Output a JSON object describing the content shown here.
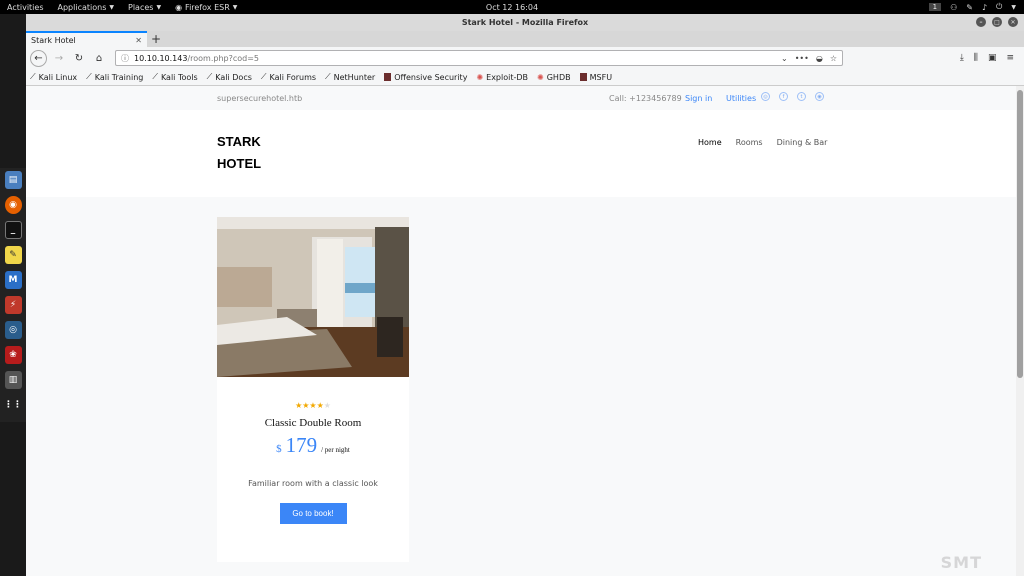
{
  "desktop": {
    "activities": "Activities",
    "applications": "Applications",
    "places": "Places",
    "app_menu": "Firefox ESR",
    "clock": "Oct 12  16:04",
    "workspace": "1"
  },
  "window": {
    "title": "Stark Hotel - Mozilla Firefox"
  },
  "tab": {
    "label": "Stark Hotel"
  },
  "urlbar": {
    "host": "10.10.10.143",
    "path": "/room.php?cod=5"
  },
  "bookmarks": [
    {
      "label": "Kali Linux"
    },
    {
      "label": "Kali Training"
    },
    {
      "label": "Kali Tools"
    },
    {
      "label": "Kali Docs"
    },
    {
      "label": "Kali Forums"
    },
    {
      "label": "NetHunter"
    },
    {
      "label": "Offensive Security"
    },
    {
      "label": "Exploit-DB"
    },
    {
      "label": "GHDB"
    },
    {
      "label": "MSFU"
    }
  ],
  "site": {
    "domain": "supersecurehotel.htb",
    "call": "Call: +123456789",
    "sign_in": "Sign in",
    "utilities": "Utilities",
    "logo_line1": "STARK",
    "logo_line2": "HOTEL",
    "nav": {
      "home": "Home",
      "rooms": "Rooms",
      "dining": "Dining & Bar"
    }
  },
  "room": {
    "rating": 4,
    "rating_max": 5,
    "name": "Classic Double Room",
    "currency": "$",
    "price": "179",
    "per_night": "/ per night",
    "description": "Familiar room with a classic look",
    "book_label": "Go to book!"
  },
  "colors": {
    "accent": "#3b86f7",
    "star": "#f2a800",
    "tab_highlight": "#0a84ff"
  }
}
